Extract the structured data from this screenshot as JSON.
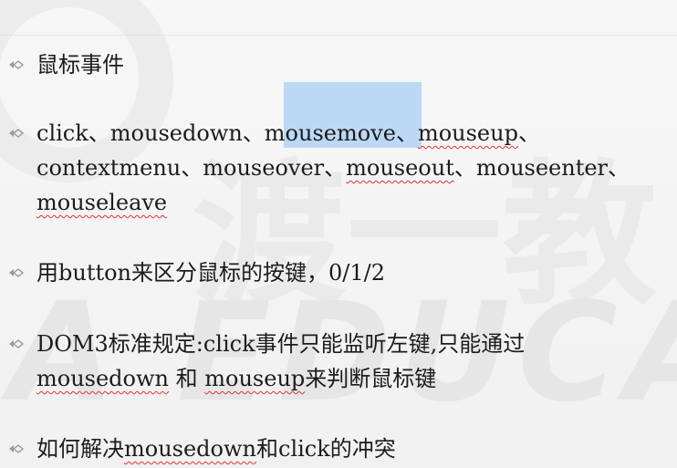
{
  "bullets": [
    {
      "segments": [
        {
          "text": "鼠标事件"
        }
      ]
    },
    {
      "lines": [
        [
          {
            "text": "click、mousedown、"
          },
          {
            "text": "mousemove",
            "sq": false
          },
          {
            "text": "、"
          },
          {
            "text": "mouseup",
            "sq": true
          },
          {
            "text": "、"
          }
        ],
        [
          {
            "text": "contextmenu、mouseover、"
          },
          {
            "text": "mouseout",
            "sq": true
          },
          {
            "text": "、mouseenter、"
          }
        ],
        [
          {
            "text": "mouseleave",
            "sq": true
          }
        ]
      ]
    },
    {
      "segments": [
        {
          "text": "用button来区分鼠标的按键，0/1/2"
        }
      ]
    },
    {
      "lines": [
        [
          {
            "text": "DOM3标准规定:click事件只能监听左键,只能通过"
          }
        ],
        [
          {
            "text": "mousedown",
            "sq": true
          },
          {
            "text": " 和 "
          },
          {
            "text": "mouseup",
            "sq": true
          },
          {
            "text": "来判断鼠标键"
          }
        ]
      ]
    },
    {
      "segments": [
        {
          "text": "如何解决"
        },
        {
          "text": "mousedown",
          "sq": true
        },
        {
          "text": "和click的冲突"
        }
      ]
    }
  ],
  "watermark": {
    "latin": "A EDUCAT",
    "cn": "渡一教"
  },
  "colors": {
    "selection": "#bcd8f5",
    "marker": "#9a9a9a",
    "spellcheck": "#dd3333"
  },
  "icons": {
    "bullet": "diamond-arrow-bullet-icon"
  }
}
